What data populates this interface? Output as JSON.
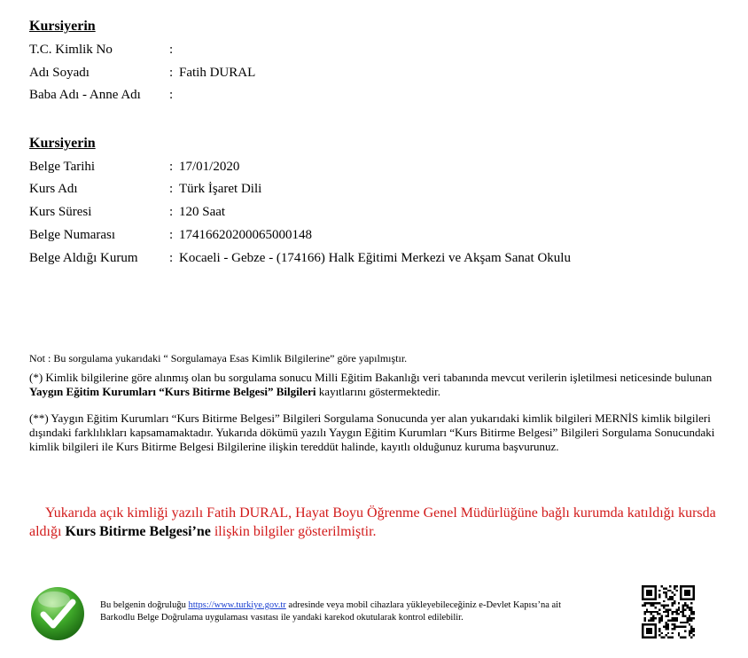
{
  "section1": {
    "title": "Kursiyerin",
    "rows": [
      {
        "label": "T.C. Kimlik No",
        "value": ""
      },
      {
        "label": "Adı Soyadı",
        "value": "Fatih DURAL"
      },
      {
        "label": "Baba Adı - Anne Adı",
        "value": ""
      }
    ]
  },
  "section2": {
    "title": "Kursiyerin",
    "rows": [
      {
        "label": "Belge Tarihi",
        "value": "17/01/2020"
      },
      {
        "label": "Kurs Adı",
        "value": "Türk İşaret Dili"
      },
      {
        "label": "Kurs Süresi",
        "value": "120 Saat"
      },
      {
        "label": "Belge Numarası",
        "value": "17416620200065000148"
      },
      {
        "label": "Belge Aldığı Kurum",
        "value": "Kocaeli - Gebze - (174166) Halk Eğitimi Merkezi ve Akşam Sanat Okulu"
      }
    ]
  },
  "colon": ":",
  "note": "Not : Bu sorgulama yukarıdaki “ Sorgulamaya Esas Kimlik Bilgilerine” göre yapılmıştır.",
  "para1": {
    "part1": "(*) Kimlik bilgilerine göre alınmış olan bu sorgulama sonucu Milli Eğitim Bakanlığı veri tabanında mevcut verilerin işletilmesi neticesinde bulunan ",
    "bold": "Yaygın Eğitim Kurumları “Kurs Bitirme Belgesi” Bilgileri",
    "part2": " kayıtlarını göstermektedir."
  },
  "para2": "(**) Yaygın Eğitim Kurumları “Kurs Bitirme Belgesi” Bilgileri Sorgulama Sonucunda yer alan yukarıdaki kimlik bilgileri MERNİS kimlik bilgileri dışındaki farklılıkları kapsamamaktadır. Yukarıda dökümü yazılı Yaygın Eğitim Kurumları “Kurs Bitirme Belgesi” Bilgileri Sorgulama Sonucundaki kimlik bilgileri ile Kurs Bitirme Belgesi Bilgilerine ilişkin tereddüt halinde, kayıtlı olduğunuz kuruma başvurunuz.",
  "statement": {
    "part1": "Yukarıda açık kimliği yazılı Fatih DURAL, Hayat Boyu Öğrenme Genel Müdürlüğüne bağlı kurumda katıldığı kursda aldığı ",
    "bold": "Kurs Bitirme Belgesi’ne",
    "part2": " ilişkin bilgiler gösterilmiştir."
  },
  "footer": {
    "part1": "Bu belgenin doğruluğu ",
    "link": "https://www.turkiye.gov.tr",
    "part2": "  adresinde veya mobil cihazlara yükleyebileceğiniz e-Devlet Kapısı’na ait Barkodlu Belge Doğrulama uygulaması vasıtası ile yandaki karekod okutularak kontrol edilebilir."
  },
  "colors": {
    "statement_red": "#d21a1a",
    "link_blue": "#1a3fd0",
    "check_green": "#3fa92a"
  },
  "icons": {
    "verified": "check-icon",
    "qr": "qr-code-icon"
  }
}
